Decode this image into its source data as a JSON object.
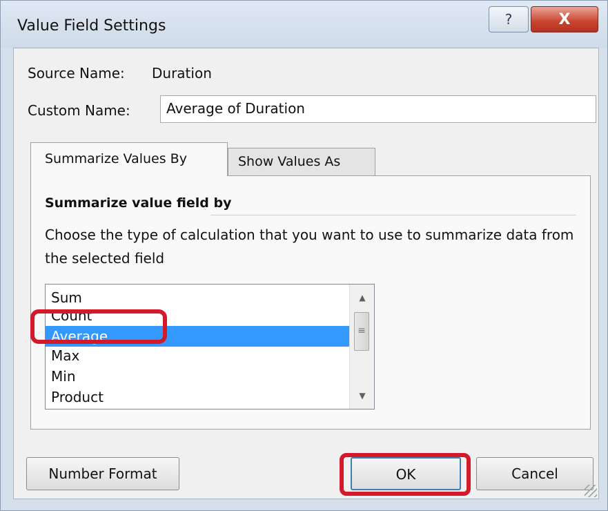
{
  "window": {
    "title": "Value Field Settings",
    "help_glyph": "?",
    "close_glyph": "X"
  },
  "source": {
    "label": "Source Name:",
    "value": "Duration"
  },
  "custom_name": {
    "label": "Custom Name:",
    "value": "Average of Duration"
  },
  "tabs": [
    {
      "label": "Summarize Values By",
      "active": true
    },
    {
      "label": "Show Values As",
      "active": false
    }
  ],
  "summarize": {
    "section_title": "Summarize value field by",
    "description": "Choose the type of calculation that you want to use to summarize data from the selected field",
    "items": [
      "Sum",
      "Count",
      "Average",
      "Max",
      "Min",
      "Product"
    ],
    "selected": "Average"
  },
  "buttons": {
    "number_format": "Number Format",
    "ok": "OK",
    "cancel": "Cancel"
  },
  "colors": {
    "selection": "#3399ff",
    "annotation": "#d21a2a"
  },
  "icons": {
    "help": "help-icon",
    "close": "close-icon",
    "scroll_up": "scroll-up-arrow-icon",
    "scroll_down": "scroll-down-arrow-icon"
  }
}
